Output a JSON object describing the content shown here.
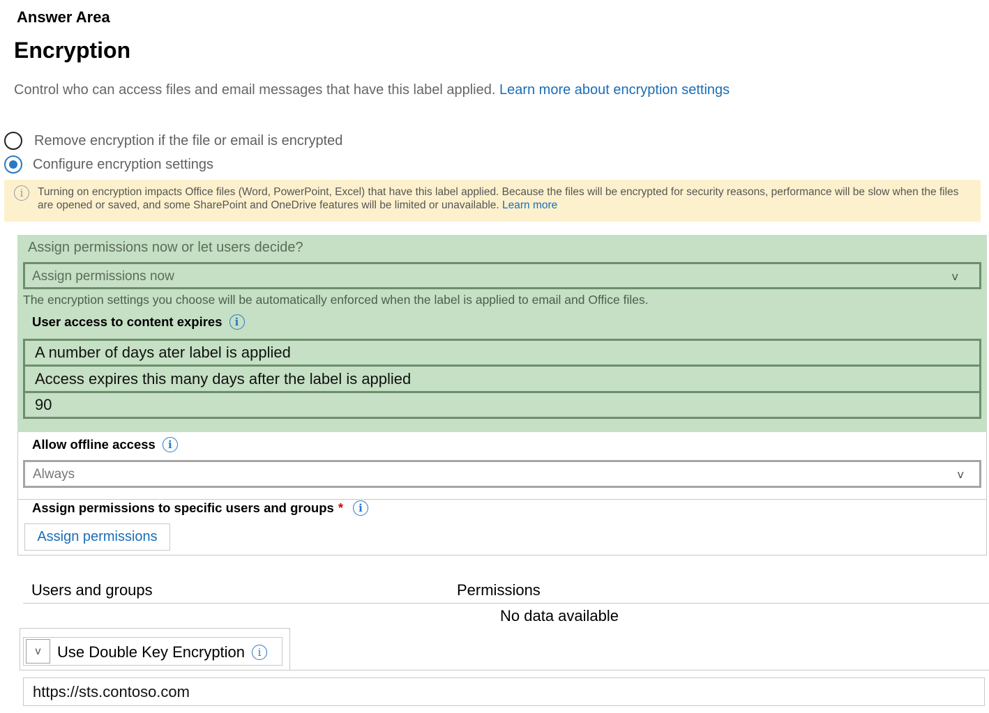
{
  "header": {
    "answer_area": "Answer Area",
    "title": "Encryption",
    "intro": "Control who can access files and email messages that have this label applied.",
    "intro_link": "Learn more about encryption settings"
  },
  "options": [
    {
      "label": "Remove encryption if the file or email is encrypted",
      "selected": false
    },
    {
      "label": "Configure encryption settings",
      "selected": true
    }
  ],
  "warning": {
    "text": "Turning on encryption impacts Office files (Word, PowerPoint, Excel) that have this label applied. Because the files will be encrypted for security reasons, performance will be slow when the files are opened or saved, and some SharePoint and OneDrive features will be limited or unavailable.",
    "link": "Learn more"
  },
  "assign_mode": {
    "label": "Assign permissions now or let users decide?",
    "selected": "Assign permissions now",
    "note": "The encryption settings you choose will be automatically enforced when the label is applied to email and Office files."
  },
  "expiry": {
    "label": "User access to content expires",
    "option": "A number of days ater label is applied",
    "days_label": "Access expires this many days after the label is applied",
    "days_value": "90"
  },
  "offline": {
    "label": "Allow offline access",
    "selected": "Always"
  },
  "assign_users": {
    "label": "Assign permissions to specific users and groups",
    "required_mark": "*",
    "button": "Assign permissions"
  },
  "table": {
    "columns": [
      "Users and groups",
      "Permissions"
    ],
    "empty": "No data available"
  },
  "dke": {
    "label": "Use Double Key Encryption",
    "url": "https://sts.contoso.com"
  },
  "icons": {
    "chevron": "v",
    "info": "i"
  },
  "colors": {
    "link": "#1a6db5",
    "highlight": "#c5e0c4",
    "warning_bg": "#fdf1cd",
    "radio_selected": "#2b78c2"
  }
}
